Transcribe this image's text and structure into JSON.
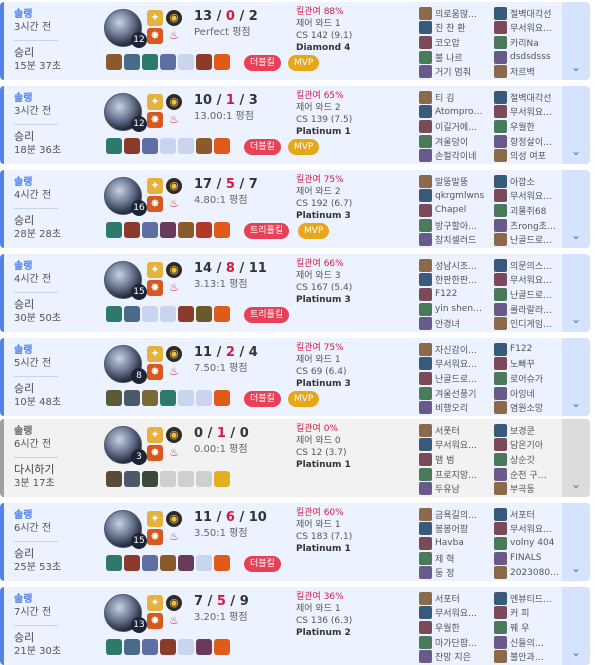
{
  "matches": [
    {
      "type": "솔랭",
      "ago": "3시간 전",
      "result": "승리",
      "duration": "15분 37초",
      "level": "12",
      "k": "13",
      "d": "0",
      "a": "2",
      "ratio": "Perfect 평점",
      "kp": "킬관여 88%",
      "wards": "제어 와드 1",
      "cs": "CS 142 (9.1)",
      "tier": "Diamond 4",
      "badges": [
        {
          "text": "더블킬",
          "kind": "multi"
        },
        {
          "text": "MVP",
          "kind": "mvp"
        }
      ],
      "items": [
        "#8a5a2b",
        "#4a6a8a",
        "#2e7a6a",
        "#5e6fa3",
        "#c9d5ee",
        "#8a3b2c",
        "#e05a1a"
      ],
      "team1": [
        "의로움많…",
        "친 찬 환",
        "코오압",
        "불 나르",
        "거기 멈춰"
      ],
      "team2": [
        "절벽대각선",
        "무서워요…",
        "카리Na",
        "dsdsdsss",
        "저르벽"
      ]
    },
    {
      "type": "솔랭",
      "ago": "3시간 전",
      "result": "승리",
      "duration": "18분 36초",
      "level": "12",
      "k": "10",
      "d": "1",
      "a": "3",
      "ratio": "13.00:1 평점",
      "kp": "킬관여 65%",
      "wards": "제어 와드 2",
      "cs": "CS 139 (7.5)",
      "tier": "Platinum 1",
      "badges": [
        {
          "text": "더블킬",
          "kind": "multi"
        },
        {
          "text": "MVP",
          "kind": "mvp"
        }
      ],
      "items": [
        "#2e7a6a",
        "#8a3b2c",
        "#5e6fa3",
        "#c9d5ee",
        "#c9d5ee",
        "#8a5a2b",
        "#e05a1a"
      ],
      "team1": [
        "티 김",
        "Atompro…",
        "이길거에…",
        "겨울덩이",
        "손절각이네"
      ],
      "team2": [
        "절벽대각선",
        "무서워요…",
        "우월한",
        "항정살이…",
        "의성 여포"
      ]
    },
    {
      "type": "솔랭",
      "ago": "4시간 전",
      "result": "승리",
      "duration": "28분 28초",
      "level": "16",
      "k": "17",
      "d": "5",
      "a": "7",
      "ratio": "4.80:1 평점",
      "kp": "킬관여 75%",
      "wards": "제어 와드 2",
      "cs": "CS 192 (6.7)",
      "tier": "Platinum 3",
      "badges": [
        {
          "text": "트리플킬",
          "kind": "multi"
        },
        {
          "text": "MVP",
          "kind": "mvp"
        }
      ],
      "items": [
        "#2e7a6a",
        "#8a3b2c",
        "#5e6fa3",
        "#6a3a5a",
        "#8a5a2b",
        "#b03a2a",
        "#e05a1a"
      ],
      "team1": [
        "말뚱말뚱",
        "qkrgmlwns",
        "Chapel",
        "방구할아…",
        "참치셀러드"
      ],
      "team2": [
        "아깝소",
        "무서워요…",
        "괴물쥐68",
        "츠rong초…",
        "난골드로…"
      ]
    },
    {
      "type": "솔랭",
      "ago": "4시간 전",
      "result": "승리",
      "duration": "30분 50초",
      "level": "15",
      "k": "14",
      "d": "8",
      "a": "11",
      "ratio": "3.13:1 평점",
      "kp": "킬관여 66%",
      "wards": "제어 와드 3",
      "cs": "CS 167 (5.4)",
      "tier": "Platinum 3",
      "badges": [
        {
          "text": "트리플킬",
          "kind": "multi"
        }
      ],
      "items": [
        "#2e7a6a",
        "#4a6a8a",
        "#c9d5ee",
        "#c9d5ee",
        "#8a3b2c",
        "#6a5a2a",
        "#e05a1a"
      ],
      "team1": [
        "성남시조…",
        "한판한판…",
        "F122",
        "yin shen…",
        "안경녀"
      ],
      "team2": [
        "의문의스…",
        "무서워요…",
        "난골드로…",
        "를라랄라…",
        "인디게임…"
      ]
    },
    {
      "type": "솔랭",
      "ago": "5시간 전",
      "result": "승리",
      "duration": "10분 48초",
      "level": "8",
      "k": "11",
      "d": "2",
      "a": "4",
      "ratio": "7.50:1 평점",
      "kp": "킬관여 75%",
      "wards": "제어 와드 1",
      "cs": "CS 69 (6.4)",
      "tier": "Platinum 3",
      "badges": [
        {
          "text": "더블킬",
          "kind": "multi"
        },
        {
          "text": "MVP",
          "kind": "mvp"
        }
      ],
      "items": [
        "#5a5a3a",
        "#4a5a6a",
        "#7a6a3a",
        "#2e7a6a",
        "#c9d5ee",
        "#c9d5ee",
        "#e05a1a"
      ],
      "team1": [
        "자신감이…",
        "무서워요…",
        "난골드로…",
        "겨울선풍기",
        "비행오리"
      ],
      "team2": [
        "F122",
        "노빠꾸",
        "로어슈가",
        "아잉네",
        "염원소망"
      ]
    },
    {
      "type": "솔랭",
      "ago": "6시간 전",
      "result": "다시하기",
      "duration": "3분 17초",
      "level": "3",
      "k": "0",
      "d": "1",
      "a": "0",
      "ratio": "0.00:1 평점",
      "kp": "킬관여 0%",
      "wards": "제어 와드 0",
      "cs": "CS 12 (3.7)",
      "tier": "Platinum 1",
      "badges": [],
      "items": [
        "#5a4a3a",
        "#4a5a6a",
        "#3a4a3a",
        "#cfcfcf",
        "#cfcfcf",
        "#cfcfcf",
        "#e0b020"
      ],
      "team1": [
        "서폿터",
        "무서워요…",
        "맴 범",
        "프로지망…",
        "두유남"
      ],
      "team2": [
        "보경쿤",
        "담온기아",
        "상순갓",
        "순천 구…",
        "부곡동"
      ],
      "remake": true
    },
    {
      "type": "솔랭",
      "ago": "6시간 전",
      "result": "승리",
      "duration": "25분 53초",
      "level": "15",
      "k": "11",
      "d": "6",
      "a": "10",
      "ratio": "3.50:1 평점",
      "kp": "킬관여 60%",
      "wards": "제어 와드 1",
      "cs": "CS 183 (7.1)",
      "tier": "Platinum 1",
      "badges": [
        {
          "text": "더블킬",
          "kind": "multi"
        }
      ],
      "items": [
        "#2e7a6a",
        "#8a3b2c",
        "#5e6fa3",
        "#8a5a2b",
        "#6a3a5a",
        "#c9d5ee",
        "#e05a1a"
      ],
      "team1": [
        "금욕길의…",
        "봉봉어팜",
        "Havba",
        "제 혁",
        "둥 정"
      ],
      "team2": [
        "서포터",
        "무서워요…",
        "volny 404",
        "FINALS",
        "2023080…"
      ]
    },
    {
      "type": "솔랭",
      "ago": "7시간 전",
      "result": "승리",
      "duration": "21분 30초",
      "level": "13",
      "k": "7",
      "d": "5",
      "a": "9",
      "ratio": "3.20:1 평점",
      "kp": "킬관여 36%",
      "wards": "제어 와드 1",
      "cs": "CS 136 (6.3)",
      "tier": "Platinum 2",
      "badges": [],
      "items": [
        "#2e7a6a",
        "#4a6a8a",
        "#5e6fa3",
        "#8a3b2c",
        "#c9d5ee",
        "#6a3a5a",
        "#e05a1a"
      ],
      "team1": [
        "서포터",
        "무서워요…",
        "우월한",
        "마가단팝…",
        "잔망 지은"
      ],
      "team2": [
        "엔뷰티드…",
        "커 피",
        "꿰 우",
        "신들의…",
        "불안과…"
      ]
    }
  ],
  "icons": {
    "expand": "chevron-down-icon"
  }
}
